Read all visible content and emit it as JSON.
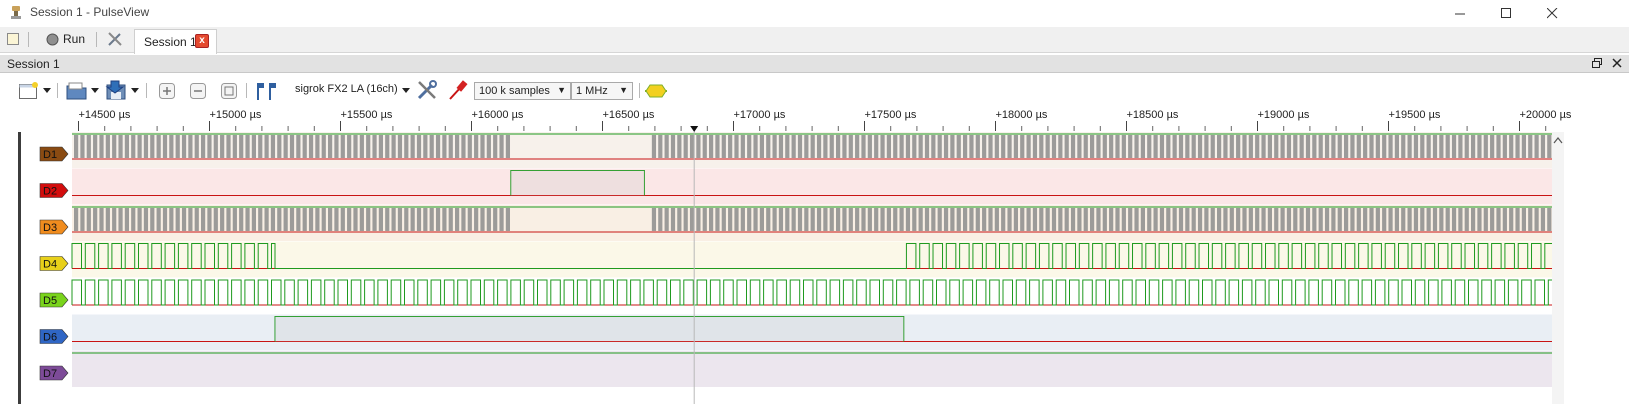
{
  "window": {
    "title": "Session 1 - PulseView",
    "minimize_icon": "minimize-icon",
    "maximize_icon": "maximize-icon",
    "close_icon": "close-icon"
  },
  "main_toolbar": {
    "run_label": "Run",
    "session_tab_label": "Session 1",
    "tab_close_glyph": "x"
  },
  "session": {
    "header_label": "Session 1"
  },
  "session_toolbar": {
    "device": "sigrok FX2 LA (16ch)",
    "sample_count": "100 k samples",
    "sample_rate": "1 MHz"
  },
  "ruler": {
    "ticks": [
      "+14500 µs",
      "+15000 µs",
      "+15500 µs",
      "+16000 µs",
      "+16500 µs",
      "+17000 µs",
      "+17500 µs",
      "+18000 µs",
      "+18500 µs",
      "+19000 µs",
      "+19500 µs",
      "+20000 µs"
    ],
    "cursor_marker": "triangle-marker"
  },
  "channels": [
    {
      "name": "D1",
      "color": "#8a4b12",
      "bg": "#f7f1eb",
      "pattern": "dense-gap",
      "gap": [
        16150,
        16660
      ]
    },
    {
      "name": "D2",
      "color": "#d20d0d",
      "bg": "#fbe7e7",
      "pattern": "pulse",
      "high": [
        16150,
        16660
      ]
    },
    {
      "name": "D3",
      "color": "#f08c1e",
      "bg": "#f9efe4",
      "pattern": "dense-gap",
      "gap": [
        16150,
        16660
      ]
    },
    {
      "name": "D4",
      "color": "#e8d01a",
      "bg": "#fbf8e8",
      "pattern": "clock-gap",
      "gap": [
        15250,
        17660
      ]
    },
    {
      "name": "D5",
      "color": "#7ad41c",
      "bg": "#ffffff",
      "pattern": "clock",
      "gap": null
    },
    {
      "name": "D6",
      "color": "#2f66c5",
      "bg": "#e9eef4",
      "pattern": "pulse",
      "high": [
        15250,
        17650
      ]
    },
    {
      "name": "D7",
      "color": "#7d4b98",
      "bg": "#ece6ee",
      "pattern": "high",
      "gap": null
    }
  ],
  "colors": {
    "wave_high": "#1f9a1f",
    "wave_low": "#c81414",
    "dense_fill": "#8c8c8c",
    "accent": "#e44a2f"
  }
}
